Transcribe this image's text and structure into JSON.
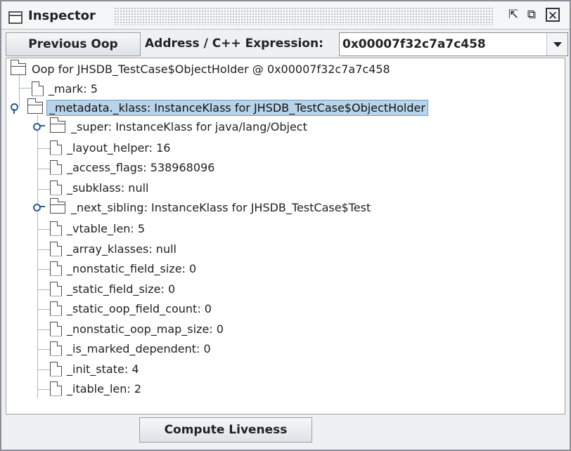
{
  "window": {
    "title": "Inspector"
  },
  "toolbar": {
    "previous_label": "Previous Oop",
    "address_label": "Address / C++ Expression:",
    "address_value": "0x00007f32c7a7c458"
  },
  "tree": {
    "root": "Oop for JHSDB_TestCase$ObjectHolder @ 0x00007f32c7a7c458",
    "mark": "_mark: 5",
    "metadata": "_metadata._klass: InstanceKlass for JHSDB_TestCase$ObjectHolder",
    "children": [
      "_super: InstanceKlass for java/lang/Object",
      "_layout_helper: 16",
      "_access_flags: 538968096",
      "_subklass: null",
      "_next_sibling: InstanceKlass for JHSDB_TestCase$Test",
      "_vtable_len: 5",
      "_array_klasses: null",
      "_nonstatic_field_size: 0",
      "_static_field_size: 0",
      "_static_oop_field_count: 0",
      "_nonstatic_oop_map_size: 0",
      "_is_marked_dependent: 0",
      "_init_state: 4",
      "_itable_len: 2"
    ]
  },
  "bottom": {
    "liveness_label": "Compute Liveness"
  },
  "icons": {
    "window": "window-icon",
    "minimize": "minimize-icon",
    "maximize": "maximize-icon",
    "close": "close-icon",
    "file": "file-icon",
    "folder": "folder-icon",
    "toggle": "tree-toggle-icon",
    "dropdown": "chevron-down-icon"
  },
  "colors": {
    "selection": "#b8d4ea",
    "toggle": "#2c5d8a",
    "tree_line": "#a9b9c9"
  }
}
